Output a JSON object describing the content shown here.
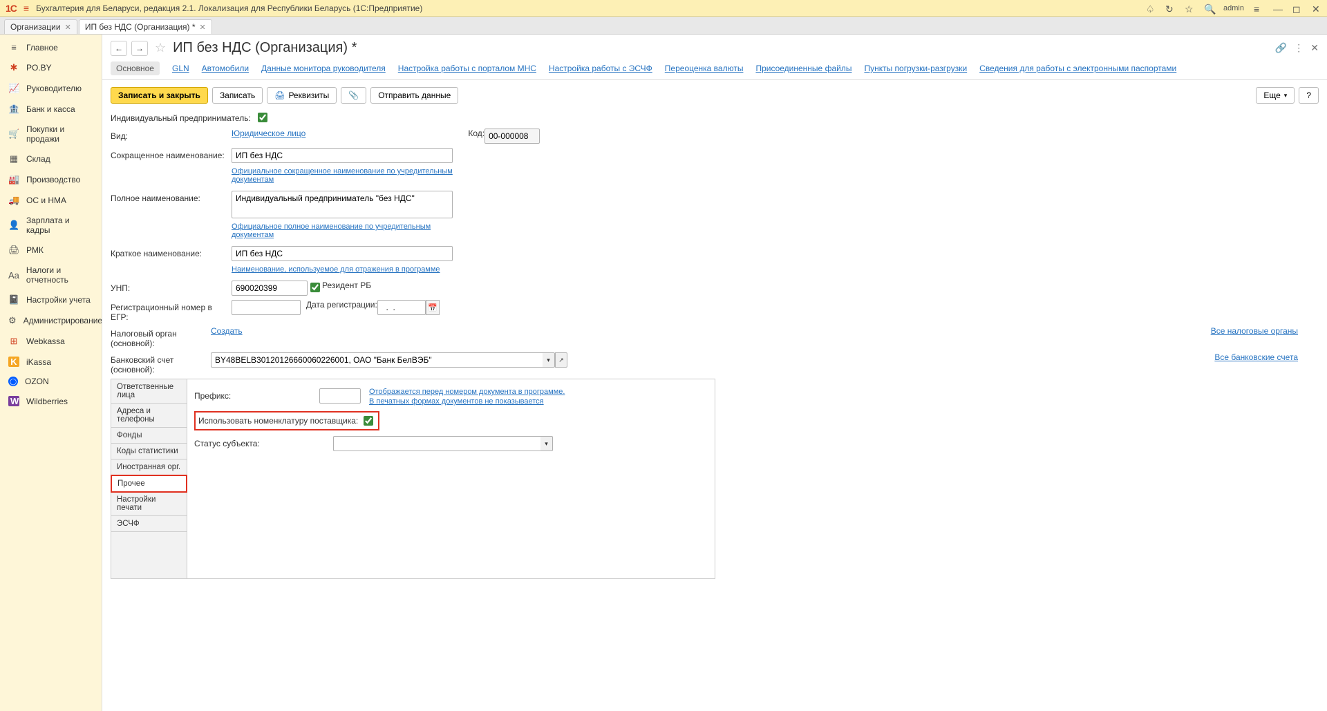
{
  "topbar": {
    "app_title": "Бухгалтерия для Беларуси, редакция 2.1. Локализация для Республики Беларусь   (1С:Предприятие)",
    "user": "admin"
  },
  "doc_tabs": [
    {
      "label": "Организации"
    },
    {
      "label": "ИП без НДС (Организация) *"
    }
  ],
  "sidebar": [
    {
      "icon": "≡",
      "label": "Главное",
      "cls": "dark"
    },
    {
      "icon": "✱",
      "label": "PO.BY",
      "cls": "red"
    },
    {
      "icon": "📈",
      "label": "Руководителю",
      "cls": "dark"
    },
    {
      "icon": "🏦",
      "label": "Банк и касса",
      "cls": "dark"
    },
    {
      "icon": "🛒",
      "label": "Покупки и продажи",
      "cls": "dark"
    },
    {
      "icon": "▦",
      "label": "Склад",
      "cls": "dark"
    },
    {
      "icon": "🏭",
      "label": "Производство",
      "cls": "dark"
    },
    {
      "icon": "🚚",
      "label": "ОС и НМА",
      "cls": "dark"
    },
    {
      "icon": "👤",
      "label": "Зарплата и кадры",
      "cls": "dark"
    },
    {
      "icon": "🖨",
      "label": "РМК",
      "cls": "dark"
    },
    {
      "icon": "Aa",
      "label": "Налоги и отчетность",
      "cls": "dark"
    },
    {
      "icon": "📓",
      "label": "Настройки учета",
      "cls": "dark"
    },
    {
      "icon": "⚙",
      "label": "Администрирование",
      "cls": "dark"
    },
    {
      "icon": "⊞",
      "label": "Webkassa",
      "cls": "red"
    },
    {
      "icon": "K",
      "label": "iKassa",
      "cls": "orange"
    },
    {
      "icon": "◯",
      "label": "OZON",
      "cls": "blue"
    },
    {
      "icon": "W",
      "label": "Wildberries",
      "cls": "purple"
    }
  ],
  "page": {
    "title": "ИП без НДС (Организация) *"
  },
  "content_tabs": [
    "Основное",
    "GLN",
    "Автомобили",
    "Данные монитора руководителя",
    "Настройка работы с порталом МНС",
    "Настройка работы с ЭСЧФ",
    "Переоценка валюты",
    "Присоединенные файлы",
    "Пункты погрузки-разгрузки",
    "Сведения для работы с электронными паспортами"
  ],
  "toolbar": {
    "save_close": "Записать и закрыть",
    "save": "Записать",
    "requisites": "Реквизиты",
    "send": "Отправить данные",
    "more": "Еще"
  },
  "form": {
    "ip_label": "Индивидуальный предприниматель:",
    "ip_checked": true,
    "vid_label": "Вид:",
    "vid_value": "Юридическое лицо",
    "kod_label": "Код:",
    "kod_value": "00-000008",
    "short_name_label": "Сокращенное наименование:",
    "short_name_value": "ИП без НДС",
    "short_name_hint": "Официальное сокращенное наименование по учредительным документам",
    "full_name_label": "Полное наименование:",
    "full_name_value": "Индивидуальный предприниматель \"без НДС\"",
    "full_name_hint": "Официальное полное наименование по учредительным документам",
    "brief_name_label": "Краткое наименование:",
    "brief_name_value": "ИП без НДС",
    "brief_name_hint": "Наименование, используемое для отражения в программе",
    "unp_label": "УНП:",
    "unp_value": "690020399",
    "resident_label": "Резидент РБ",
    "resident_checked": true,
    "egr_label": "Регистрационный номер в ЕГР:",
    "reg_date_label": "Дата регистрации:",
    "reg_date_value": "  .  .    ",
    "tax_label": "Налоговый орган (основной):",
    "tax_create": "Создать",
    "all_tax": "Все налоговые органы",
    "bank_label": "Банковский счет (основной):",
    "bank_value": "BY48BELB30120126660060226001, ОАО \"Банк БелВЭБ\"",
    "all_banks": "Все банковские счета"
  },
  "side_tabs": [
    "Ответственные лица",
    "Адреса и телефоны",
    "Фонды",
    "Коды статистики",
    "Иностранная орг.",
    "Прочее",
    "Настройки печати",
    "ЭСЧФ"
  ],
  "panel": {
    "prefix_label": "Префикс:",
    "prefix_hint1": "Отображается перед номером документа в программе.",
    "prefix_hint2": "В печатных формах документов не показывается",
    "nomenclature_label": "Использовать номенклатуру поставщика:",
    "status_label": "Статус субъекта:"
  }
}
